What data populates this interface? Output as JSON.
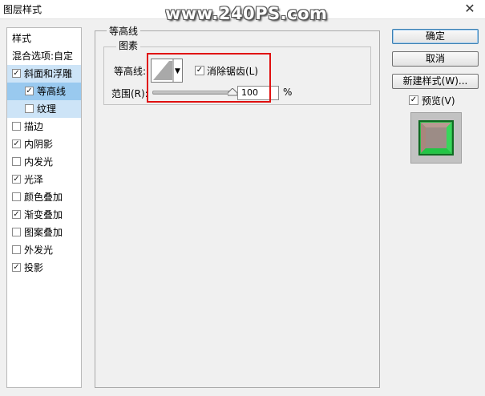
{
  "window": {
    "title": "图层样式",
    "watermark": "www.240PS.com",
    "close_icon": "close-icon"
  },
  "stylelist": {
    "items": [
      {
        "label": "样式",
        "has_checkbox": false,
        "checked": false
      },
      {
        "label": "混合选项:自定",
        "has_checkbox": false,
        "checked": false
      },
      {
        "label": "斜面和浮雕",
        "has_checkbox": true,
        "checked": true
      },
      {
        "label": "等高线",
        "has_checkbox": true,
        "checked": true
      },
      {
        "label": "纹理",
        "has_checkbox": true,
        "checked": false
      },
      {
        "label": "描边",
        "has_checkbox": true,
        "checked": false
      },
      {
        "label": "内阴影",
        "has_checkbox": true,
        "checked": true
      },
      {
        "label": "内发光",
        "has_checkbox": true,
        "checked": false
      },
      {
        "label": "光泽",
        "has_checkbox": true,
        "checked": true
      },
      {
        "label": "颜色叠加",
        "has_checkbox": true,
        "checked": false
      },
      {
        "label": "渐变叠加",
        "has_checkbox": true,
        "checked": true
      },
      {
        "label": "图案叠加",
        "has_checkbox": true,
        "checked": false
      },
      {
        "label": "外发光",
        "has_checkbox": true,
        "checked": false
      },
      {
        "label": "投影",
        "has_checkbox": true,
        "checked": true
      }
    ],
    "selected_bg": "#cde4f7",
    "active_bg": "#99c9ef"
  },
  "panel": {
    "group_title": "等高线",
    "sub_group_title": "图素",
    "contour_label": "等高线:",
    "antialias_label": "消除锯齿(L)",
    "antialias_checked": true,
    "range_label": "范围(R):",
    "range_value": "100",
    "range_unit": "%",
    "range_fraction": 1.0,
    "highlight_color": "#e01010"
  },
  "buttons": {
    "ok": "确定",
    "cancel": "取消",
    "new_style": "新建样式(W)...",
    "preview_label": "预览(V)",
    "preview_checked": true
  },
  "check_glyph": "✓"
}
